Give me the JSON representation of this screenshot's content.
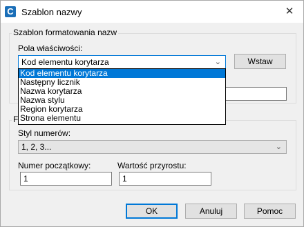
{
  "window": {
    "title": "Szablon nazwy",
    "app_icon_letter": "C",
    "close_glyph": "✕"
  },
  "group_format": {
    "legend": "Szablon formatowania nazw",
    "prop_label": "Pola właściwości:",
    "prop_selected": "Kod elementu korytarza",
    "insert_button": "Wstaw",
    "dropdown_options": [
      "Kod elementu korytarza",
      "Następny licznik",
      "Nazwa korytarza",
      "Nazwa stylu",
      "Region korytarza",
      "Strona elementu"
    ],
    "template_value": ""
  },
  "group_numbering": {
    "legend_partial": "F",
    "style_label": "Styl numerów:",
    "style_value": "1, 2, 3...",
    "start_label": "Numer początkowy:",
    "start_value": "1",
    "increment_label": "Wartość przyrostu:",
    "increment_value": "1"
  },
  "buttons": {
    "ok": "OK",
    "cancel": "Anuluj",
    "help": "Pomoc"
  }
}
